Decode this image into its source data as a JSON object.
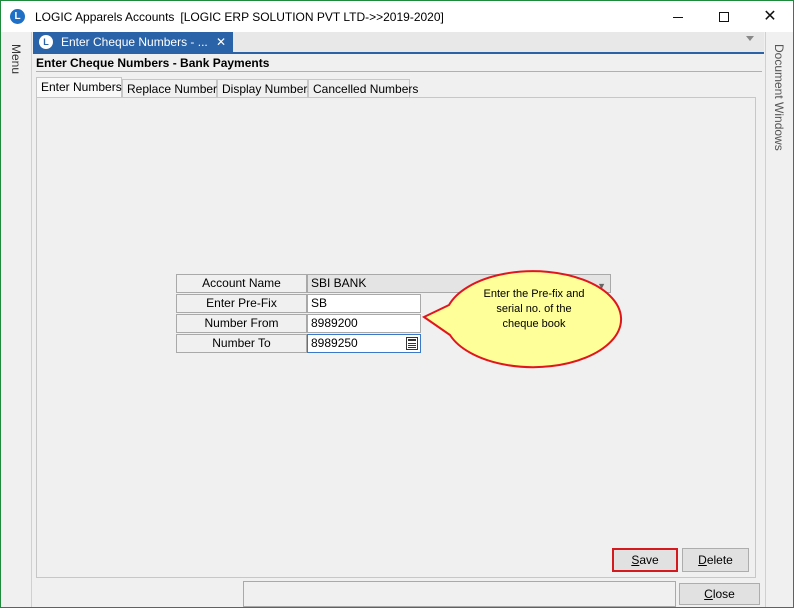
{
  "window": {
    "app_icon": "logic-app-icon",
    "title": "LOGIC Apparels Accounts",
    "company": "[LOGIC ERP SOLUTION PVT LTD->>2019-2020]"
  },
  "sidebar_left": {
    "label": "Menu"
  },
  "sidebar_right": {
    "label": "Document Windows"
  },
  "doc_tab": {
    "label": "Enter Cheque Numbers - ...",
    "close": "✕"
  },
  "form": {
    "title": "Enter Cheque Numbers - Bank Payments",
    "tabs": [
      {
        "label": "Enter Numbers",
        "active": true
      },
      {
        "label": "Replace Numbers",
        "active": false
      },
      {
        "label": "Display Numbers",
        "active": false
      },
      {
        "label": "Cancelled Numbers",
        "active": false
      }
    ],
    "fields": {
      "account_name": {
        "label": "Account Name",
        "value": "SBI BANK"
      },
      "prefix": {
        "label": "Enter Pre-Fix",
        "value": "SB"
      },
      "number_from": {
        "label": "Number From",
        "value": "8989200"
      },
      "number_to": {
        "label": "Number To",
        "value": "8989250"
      }
    }
  },
  "callout": {
    "line1": "Enter the Pre-fix and",
    "line2": "serial no. of the",
    "line3": "cheque book",
    "fill_color": "#ffff99",
    "border_color": "#e0161e"
  },
  "buttons": {
    "save": {
      "label_pre": "",
      "mnemonic": "S",
      "label_post": "ave"
    },
    "delete": {
      "label_pre": "",
      "mnemonic": "D",
      "label_post": "elete"
    },
    "close": {
      "label_pre": "",
      "mnemonic": "C",
      "label_post": "lose"
    }
  }
}
